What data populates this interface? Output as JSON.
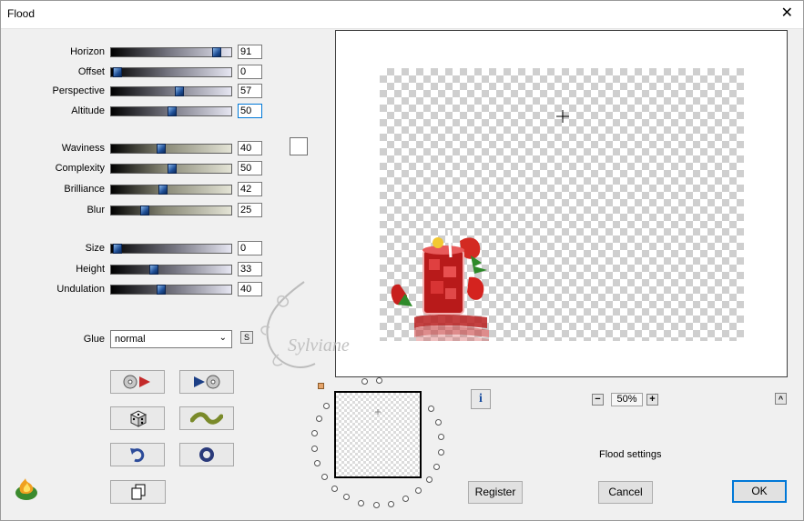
{
  "window": {
    "title": "Flood",
    "close_glyph": "✕"
  },
  "sliders": [
    {
      "name": "horizon",
      "label": "Horizon",
      "value": "91",
      "level": 91,
      "style": "grad-a"
    },
    {
      "name": "offset",
      "label": "Offset",
      "value": "0",
      "level": 0,
      "style": "grad-a"
    },
    {
      "name": "perspective",
      "label": "Perspective",
      "value": "57",
      "level": 57,
      "style": "grad-a"
    },
    {
      "name": "altitude",
      "label": "Altitude",
      "value": "50",
      "level": 50,
      "style": "grad-a",
      "focused": true
    },
    {
      "name": "waviness",
      "label": "Waviness",
      "value": "40",
      "level": 40,
      "style": "grad-b"
    },
    {
      "name": "complexity",
      "label": "Complexity",
      "value": "50",
      "level": 50,
      "style": "grad-b"
    },
    {
      "name": "brilliance",
      "label": "Brilliance",
      "value": "42",
      "level": 42,
      "style": "grad-b"
    },
    {
      "name": "blur",
      "label": "Blur",
      "value": "25",
      "level": 25,
      "style": "grad-b"
    },
    {
      "name": "size",
      "label": "Size",
      "value": "0",
      "level": 0,
      "style": "grad-c"
    },
    {
      "name": "height",
      "label": "Height",
      "value": "33",
      "level": 33,
      "style": "grad-c"
    },
    {
      "name": "undulation",
      "label": "Undulation",
      "value": "40",
      "level": 40,
      "style": "grad-c"
    }
  ],
  "glue": {
    "label": "Glue",
    "value": "normal",
    "s_button": "S"
  },
  "zoom": {
    "value": "50%",
    "minus": "−",
    "plus": "+"
  },
  "info_glyph": "i",
  "collapse_glyph": "^",
  "status_text": "Flood settings",
  "buttons": {
    "register": "Register",
    "cancel": "Cancel",
    "ok": "OK"
  },
  "colors": {
    "thumb": "#1f4f96",
    "accent": "#0078d7",
    "drink_red": "#c8201e"
  }
}
